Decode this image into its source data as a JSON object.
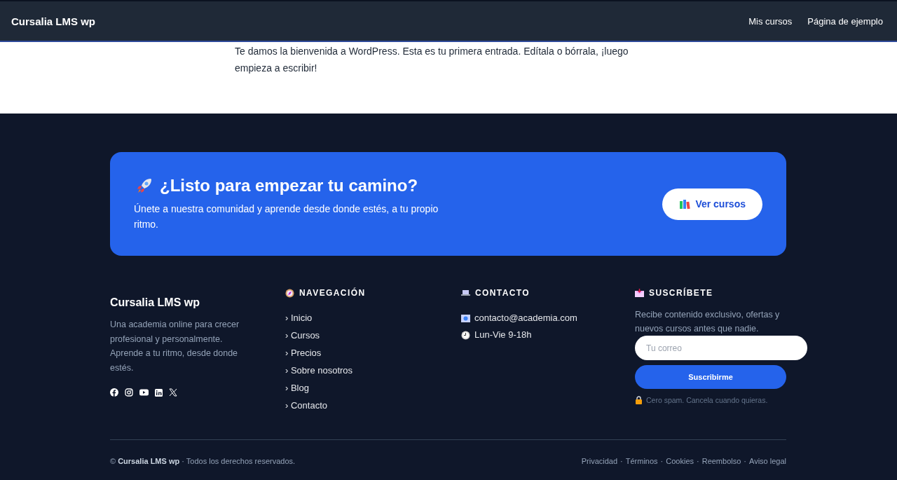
{
  "header": {
    "site_title": "Cursalia LMS wp",
    "menu": [
      "Mis cursos",
      "Página de ejemplo"
    ]
  },
  "post": {
    "text": "Te damos la bienvenida a WordPress. Esta es tu primera entrada. Edítala o bórrala, ¡luego empieza a escribir!"
  },
  "cta": {
    "title": "¿Listo para empezar tu camino?",
    "subtitle": "Únete a nuestra comunidad y aprende desde donde estés, a tu propio ritmo.",
    "button": "Ver cursos"
  },
  "about": {
    "title": "Cursalia LMS wp",
    "text": "Una academia online para crecer profesional y personalmente. Aprende a tu ritmo, desde donde estés.",
    "social": [
      {
        "kind": "facebook"
      },
      {
        "kind": "instagram"
      },
      {
        "kind": "youtube"
      },
      {
        "kind": "linkedin"
      },
      {
        "kind": "x"
      }
    ]
  },
  "navigation": {
    "heading": "NAVEGACIÓN",
    "links": [
      "› Inicio",
      "› Cursos",
      "› Precios",
      "› Sobre nosotros",
      "› Blog",
      "› Contacto"
    ]
  },
  "contact": {
    "heading": "CONTACTO",
    "items": [
      {
        "kind": "email",
        "text": "contacto@academia.com"
      },
      {
        "kind": "hours",
        "text": "Lun-Vie 9-18h"
      }
    ]
  },
  "subscribe": {
    "heading": "SUSCRÍBETE",
    "text": "Recibe contenido exclusivo, ofertas y nuevos cursos antes que nadie.",
    "placeholder": "Tu correo",
    "button": "Suscribirme",
    "note": "Cero spam. Cancela cuando quieras."
  },
  "bottom": {
    "copyright": "© **Cursalia LMS wp** · Todos los derechos reservados.",
    "separator": "·",
    "links": [
      "Privacidad",
      "Términos",
      "Cookies",
      "Reembolso",
      "Aviso legal"
    ]
  }
}
